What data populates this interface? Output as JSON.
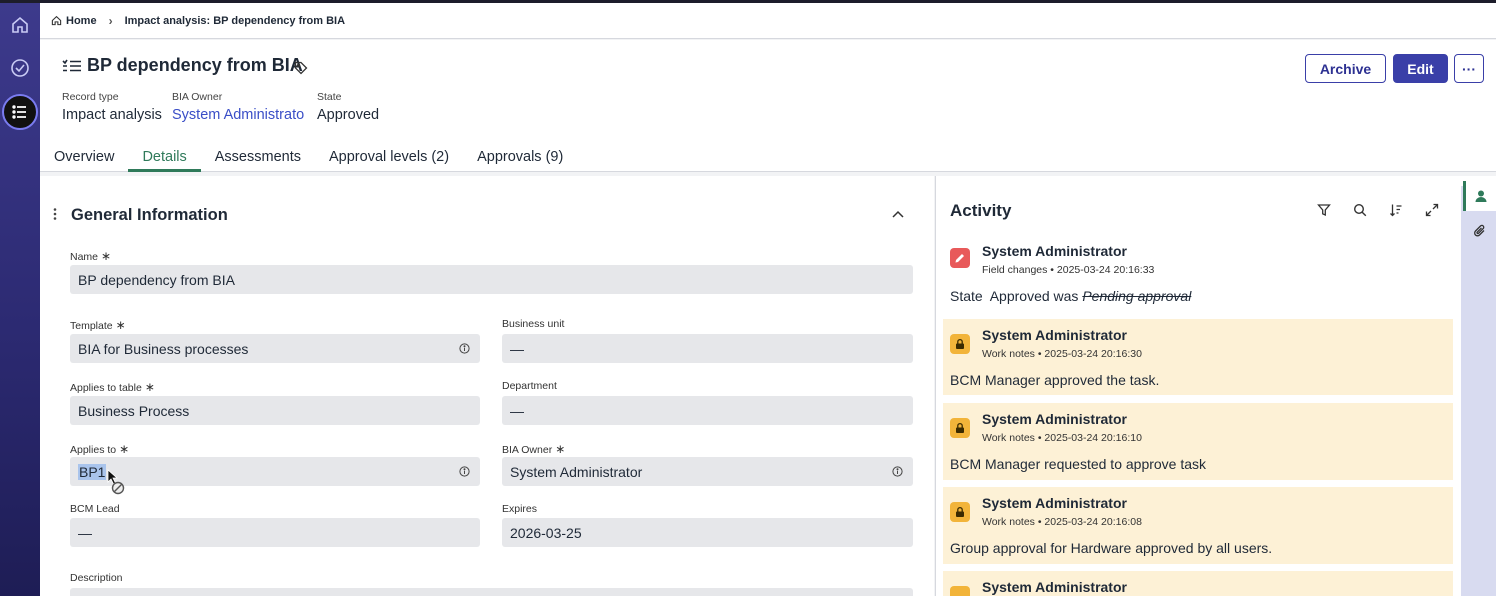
{
  "breadcrumb": {
    "home": "Home",
    "current": "Impact analysis: BP dependency from BIA"
  },
  "record": {
    "title": "BP dependency from BIA",
    "meta": [
      {
        "label": "Record type",
        "value": "Impact analysis"
      },
      {
        "label": "BIA Owner",
        "value": "System Administrato"
      },
      {
        "label": "State",
        "value": "Approved"
      }
    ],
    "actions": {
      "archive": "Archive",
      "edit": "Edit",
      "more": "···"
    }
  },
  "tabs": [
    "Overview",
    "Details",
    "Assessments",
    "Approval levels (2)",
    "Approvals (9)"
  ],
  "active_tab": "Details",
  "form": {
    "section_title": "General Information",
    "required_mark": "∗",
    "fields": {
      "name": {
        "label": "Name",
        "value": "BP dependency from BIA"
      },
      "template": {
        "label": "Template",
        "value": "BIA for Business processes"
      },
      "business_unit": {
        "label": "Business unit",
        "value": "—"
      },
      "applies_to_table": {
        "label": "Applies to table",
        "value": "Business Process"
      },
      "department": {
        "label": "Department",
        "value": "—"
      },
      "applies_to": {
        "label": "Applies to",
        "value": "BP1"
      },
      "bia_owner": {
        "label": "BIA Owner",
        "value": "System Administrator"
      },
      "bcm_lead": {
        "label": "BCM Lead",
        "value": "—"
      },
      "expires": {
        "label": "Expires",
        "value": "2026-03-25"
      },
      "description": {
        "label": "Description"
      }
    }
  },
  "activity": {
    "title": "Activity",
    "entries": [
      {
        "type": "field-changes",
        "author": "System Administrator",
        "meta": "Field changes • 2025-03-24 20:16:33",
        "field": "State",
        "new_value": "Approved was",
        "old_value": "Pending approval"
      },
      {
        "type": "work-notes",
        "author": "System Administrator",
        "meta": "Work notes • 2025-03-24 20:16:30",
        "text": "BCM Manager approved the task."
      },
      {
        "type": "work-notes",
        "author": "System Administrator",
        "meta": "Work notes • 2025-03-24 20:16:10",
        "text": "BCM Manager requested to approve task"
      },
      {
        "type": "work-notes",
        "author": "System Administrator",
        "meta": "Work notes • 2025-03-24 20:16:08",
        "text": "Group approval for Hardware approved by all users."
      },
      {
        "type": "work-notes",
        "author": "System Administrator"
      }
    ]
  },
  "icons": {
    "rail": [
      "home-icon",
      "check-circle-icon",
      "list-icon"
    ],
    "activity_tools": [
      "filter-icon",
      "search-icon",
      "sort-icon",
      "expand-icon"
    ],
    "utility_rail": [
      "user-icon",
      "paperclip-icon"
    ]
  }
}
